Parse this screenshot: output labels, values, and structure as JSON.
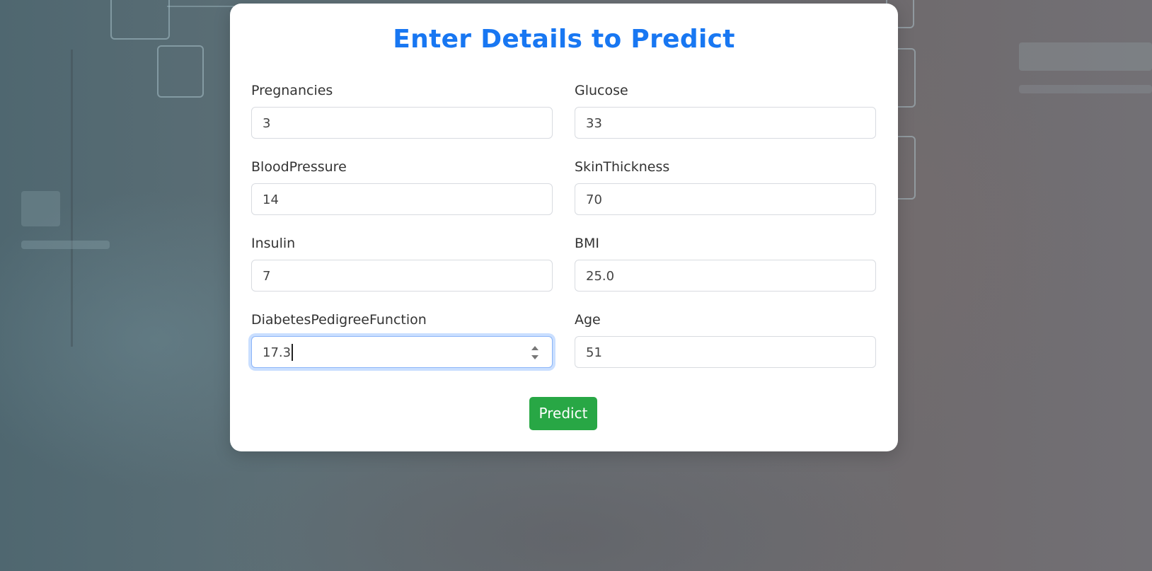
{
  "form": {
    "title": "Enter Details to Predict",
    "fields": [
      {
        "label": "Pregnancies",
        "value": "3"
      },
      {
        "label": "Glucose",
        "value": "33"
      },
      {
        "label": "BloodPressure",
        "value": "14"
      },
      {
        "label": "SkinThickness",
        "value": "70"
      },
      {
        "label": "Insulin",
        "value": "7"
      },
      {
        "label": "BMI",
        "value": "25.0"
      },
      {
        "label": "DiabetesPedigreeFunction",
        "value": "17.3"
      },
      {
        "label": "Age",
        "value": "51"
      }
    ],
    "submit_label": "Predict"
  },
  "colors": {
    "title": "#1877f2",
    "submit_button": "#28a745",
    "focus_ring": "#8ab4f8"
  },
  "icons": {
    "number_spinner": "spinner-arrows-icon"
  }
}
